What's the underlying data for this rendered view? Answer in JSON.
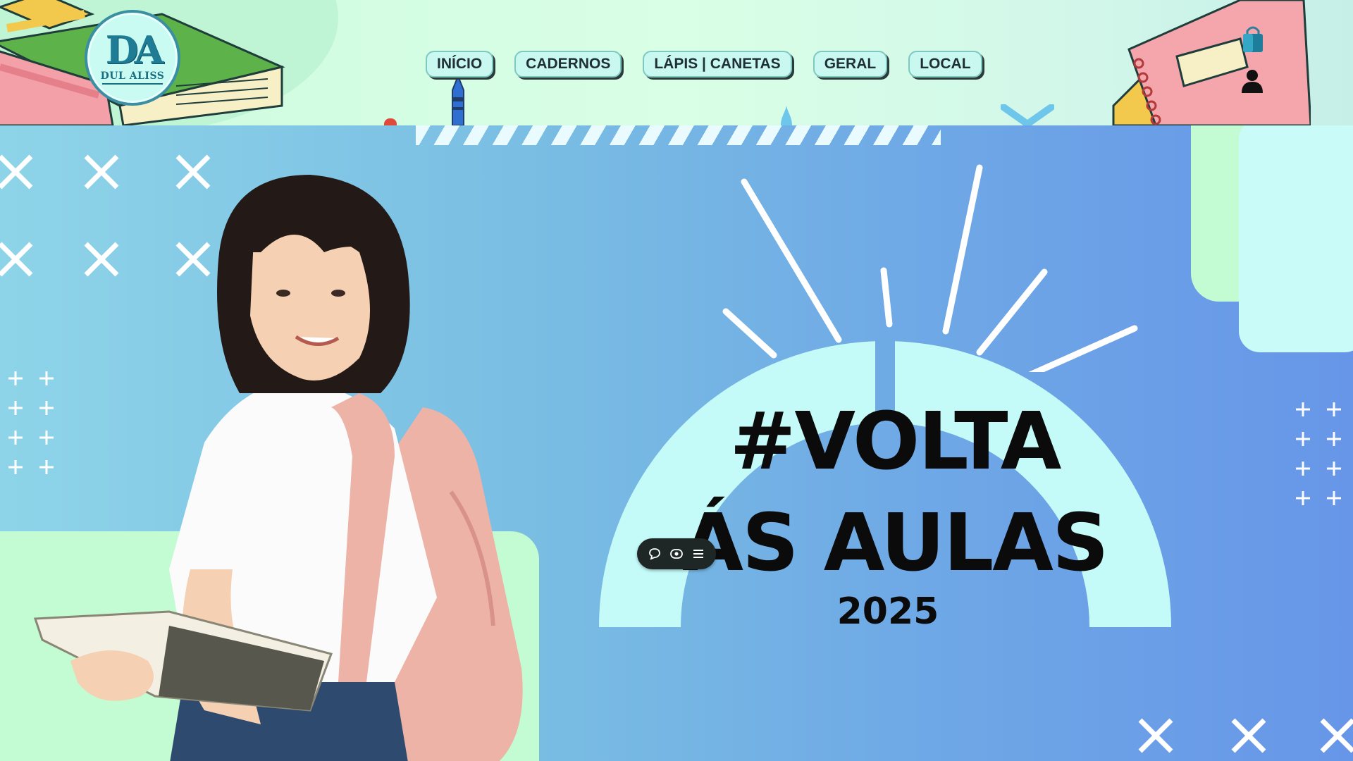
{
  "brand": {
    "logo_mark": "DA",
    "logo_text": "DUL ALISS"
  },
  "nav": {
    "items": [
      {
        "label": "INÍCIO"
      },
      {
        "label": "CADERNOS"
      },
      {
        "label": "LÁPIS | CANETAS"
      },
      {
        "label": "GERAL"
      },
      {
        "label": "LOCAL"
      }
    ]
  },
  "header_icons": {
    "cart": "shopping-bag-icon",
    "account": "user-icon"
  },
  "hero": {
    "headline_line1": "#VOLTA",
    "headline_line2": "ÁS AULAS",
    "year": "2025"
  },
  "floating_toolbar": {
    "icons": [
      "comment-icon",
      "preview-icon",
      "menu-icon"
    ]
  },
  "colors": {
    "hero_gradient_start": "#8ed4e8",
    "hero_gradient_end": "#6796e8",
    "mint": "#c3fbd3",
    "nav_button_bg": "#c8f8f0",
    "arch": "#c4fbf9",
    "headline": "#0b0b0b"
  }
}
